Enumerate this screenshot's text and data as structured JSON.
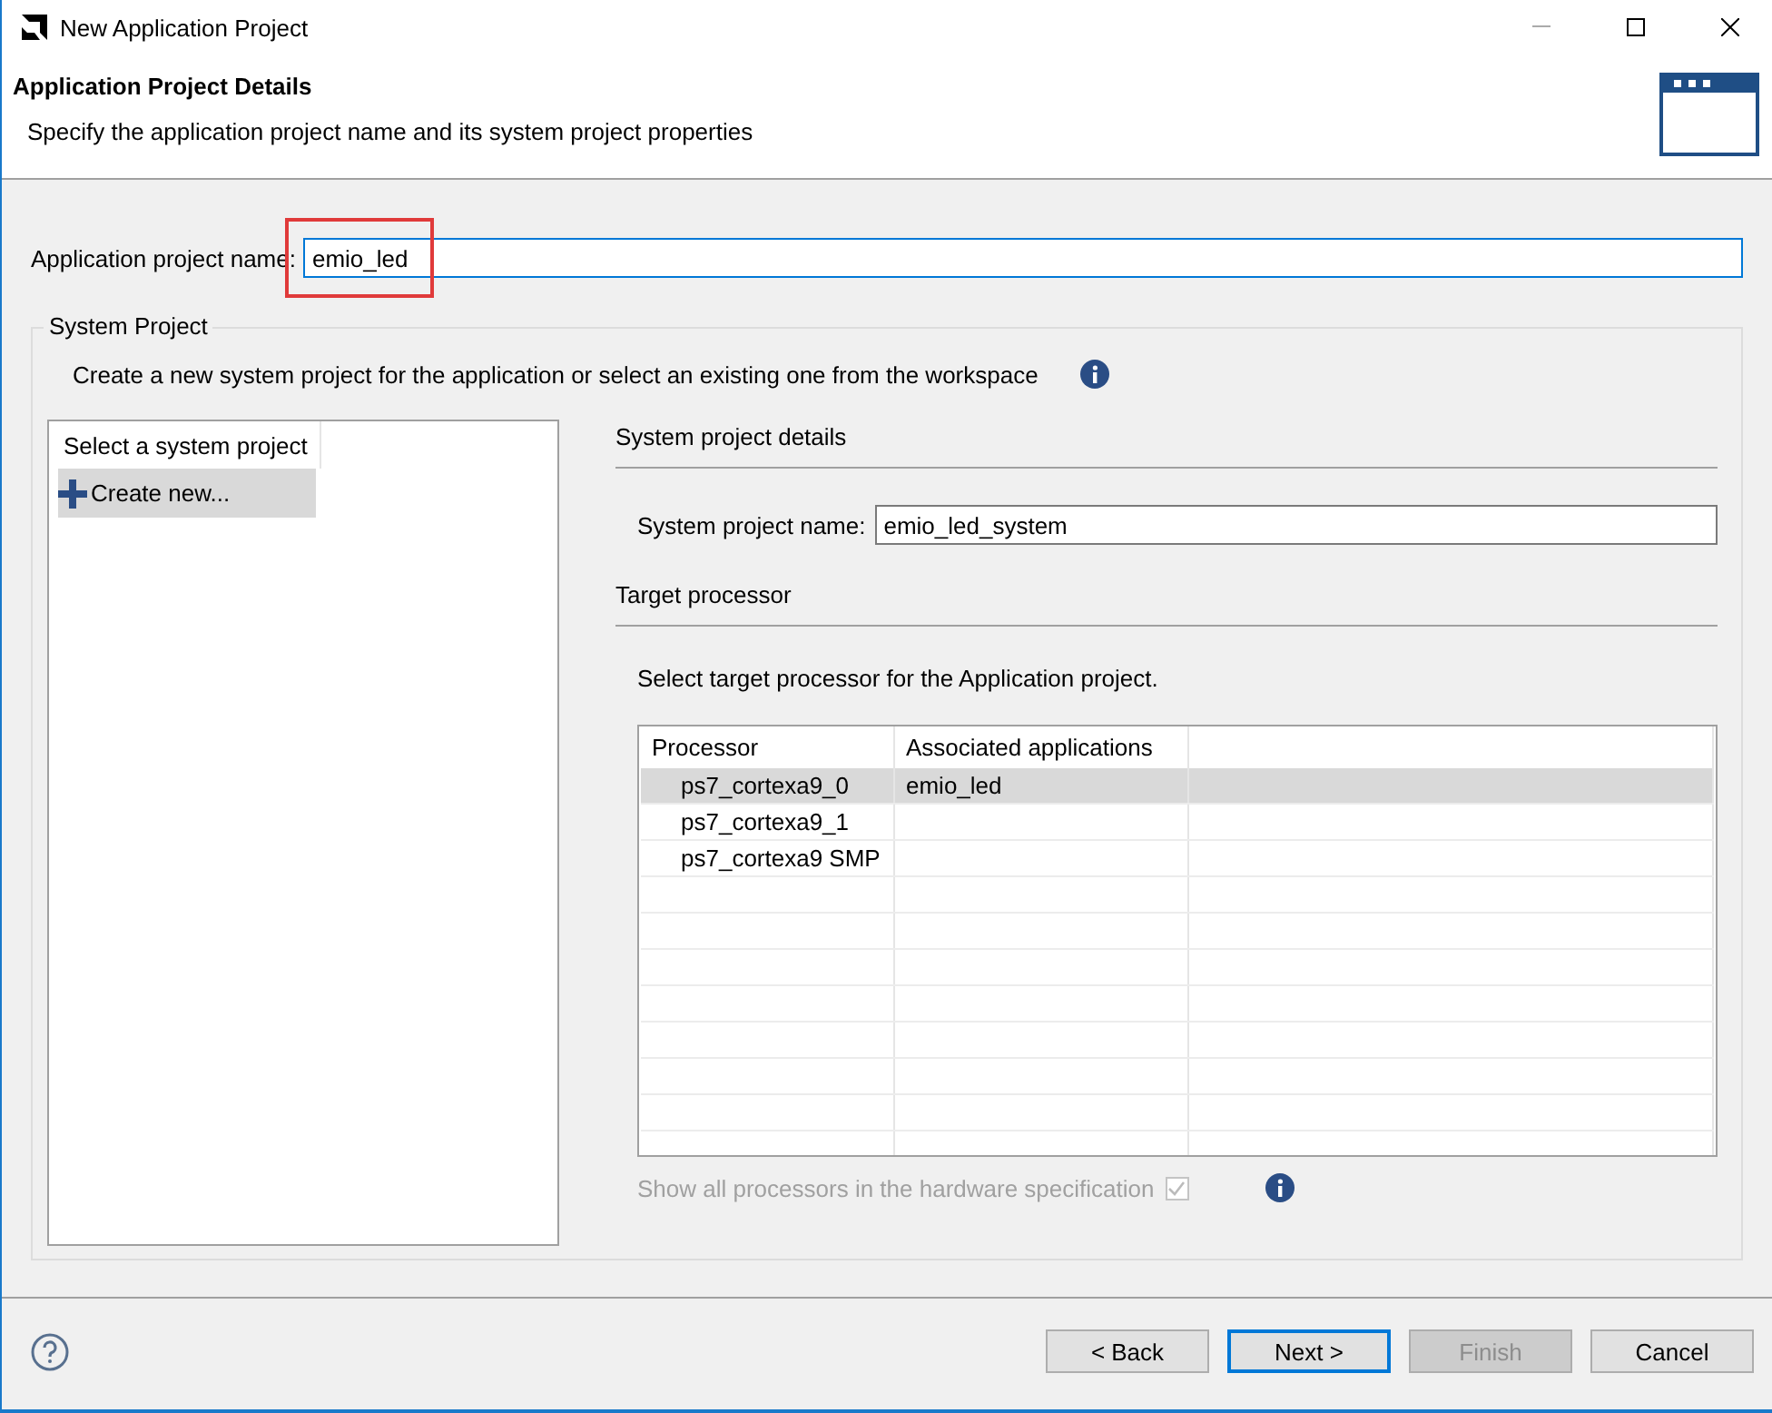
{
  "window": {
    "title": "New Application Project"
  },
  "header": {
    "title": "Application Project Details",
    "subtitle": "Specify the application project name and its system project properties"
  },
  "app_name": {
    "label": "Application project name:",
    "value": "emio_led",
    "highlighted": true
  },
  "system_project": {
    "legend": "System Project",
    "description": "Create a new system project for the application or select an existing one from the workspace",
    "list": {
      "header": "Select a system project",
      "items": [
        {
          "label": "Create new...",
          "selected": true
        }
      ]
    },
    "details": {
      "heading": "System project details",
      "name_label": "System project name:",
      "name_value": "emio_led_system"
    },
    "target": {
      "heading": "Target processor",
      "instruction": "Select target processor for the Application project.",
      "table": {
        "columns": [
          "Processor",
          "Associated applications"
        ],
        "rows": [
          {
            "cells": [
              "ps7_cortexa9_0",
              "emio_led"
            ],
            "selected": true
          },
          {
            "cells": [
              "ps7_cortexa9_1",
              ""
            ],
            "selected": false
          },
          {
            "cells": [
              "ps7_cortexa9 SMP",
              ""
            ],
            "selected": false
          }
        ]
      },
      "show_all": {
        "label": "Show all processors in the hardware specification",
        "checked": true,
        "disabled": true
      }
    }
  },
  "buttons": [
    {
      "label": "< Back",
      "focused": false,
      "disabled": false
    },
    {
      "label": "Next >",
      "focused": true,
      "disabled": false
    },
    {
      "label": "Finish",
      "focused": false,
      "disabled": true
    },
    {
      "label": "Cancel",
      "focused": false,
      "disabled": false
    }
  ]
}
